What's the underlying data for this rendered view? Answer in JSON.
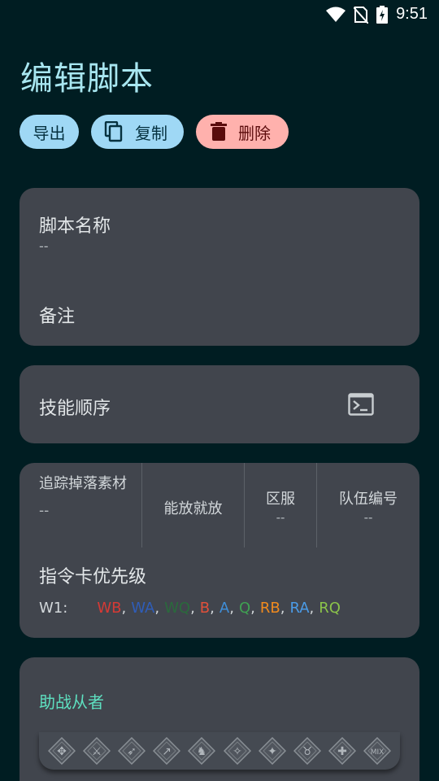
{
  "status_bar": {
    "time": "9:51"
  },
  "title": "编辑脚本",
  "actions": {
    "export_label": "导出",
    "copy_label": "复制",
    "delete_label": "删除"
  },
  "script_info": {
    "name_label": "脚本名称",
    "name_value": "--",
    "note_label": "备注"
  },
  "skill_order": {
    "label": "技能顺序"
  },
  "options": {
    "track_drop": {
      "label": "追踪掉落素材",
      "value": "--"
    },
    "cast_ready": {
      "label": "能放就放"
    },
    "server": {
      "label": "区服",
      "value": "--"
    },
    "party": {
      "label": "队伍编号",
      "value": "--"
    }
  },
  "card_priority": {
    "label": "指令卡优先级",
    "wave_label": "W1:",
    "cards": [
      {
        "text": "WB",
        "color": "#d53a35"
      },
      {
        "text": "WA",
        "color": "#2f5db8"
      },
      {
        "text": "WQ",
        "color": "#2a6a3c"
      },
      {
        "text": "B",
        "color": "#e0503a"
      },
      {
        "text": "A",
        "color": "#3f8ed8"
      },
      {
        "text": "Q",
        "color": "#3fa152"
      },
      {
        "text": "RB",
        "color": "#f08a1e"
      },
      {
        "text": "RA",
        "color": "#4b9be6"
      },
      {
        "text": "RQ",
        "color": "#8bc34a"
      }
    ]
  },
  "support": {
    "label": "助战从者",
    "label_color": "#5ee0c0",
    "class_icons": [
      "all-class-icon",
      "saber-icon",
      "archer-icon",
      "lancer-icon",
      "rider-icon",
      "caster-icon",
      "assassin-icon",
      "berserker-icon",
      "extra-icon",
      "mix-icon"
    ],
    "mix_label": "MIX"
  }
}
